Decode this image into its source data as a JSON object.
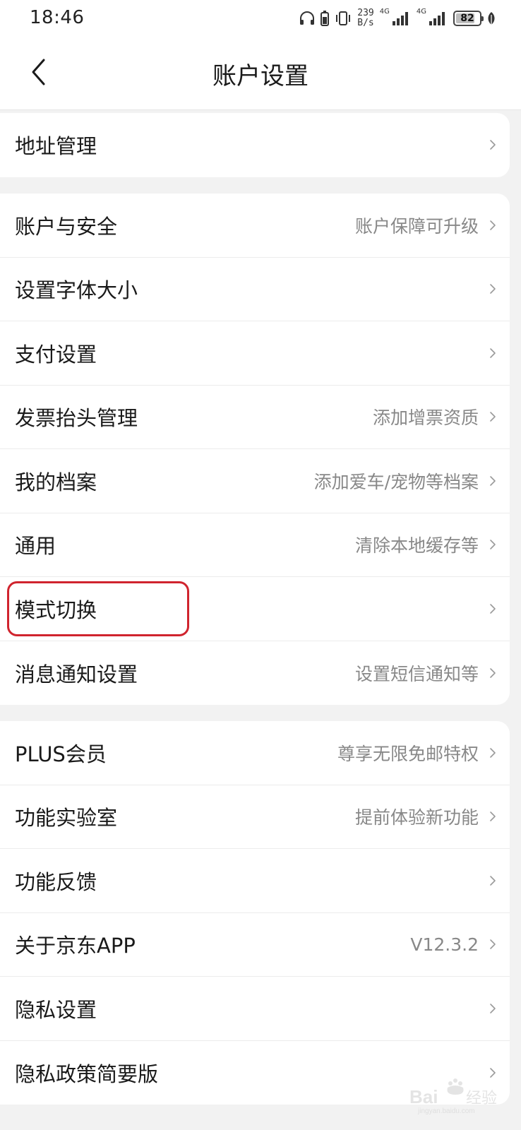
{
  "status_bar": {
    "time": "18:46",
    "net_speed_value": "239",
    "net_speed_unit": "B/s",
    "signal1_label": "4G",
    "signal2_label": "4G",
    "battery_level": "82",
    "battery_fraction": 0.82
  },
  "nav": {
    "title": "账户设置"
  },
  "groups": [
    {
      "items": [
        {
          "label": "地址管理",
          "hint": ""
        }
      ]
    },
    {
      "items": [
        {
          "label": "账户与安全",
          "hint": "账户保障可升级"
        },
        {
          "label": "设置字体大小",
          "hint": ""
        },
        {
          "label": "支付设置",
          "hint": ""
        },
        {
          "label": "发票抬头管理",
          "hint": "添加增票资质"
        },
        {
          "label": "我的档案",
          "hint": "添加爱车/宠物等档案"
        },
        {
          "label": "通用",
          "hint": "清除本地缓存等"
        },
        {
          "label": "模式切换",
          "hint": ""
        },
        {
          "label": "消息通知设置",
          "hint": "设置短信通知等"
        }
      ]
    },
    {
      "items": [
        {
          "label": "PLUS会员",
          "hint": "尊享无限免邮特权"
        },
        {
          "label": "功能实验室",
          "hint": "提前体验新功能"
        },
        {
          "label": "功能反馈",
          "hint": ""
        },
        {
          "label": "关于京东APP",
          "hint": "V12.3.2"
        },
        {
          "label": "隐私设置",
          "hint": ""
        },
        {
          "label": "隐私政策简要版",
          "hint": ""
        }
      ]
    }
  ],
  "colors": {
    "highlight": "#d0242e",
    "hint_text": "#888888",
    "background": "#f2f2f2"
  }
}
